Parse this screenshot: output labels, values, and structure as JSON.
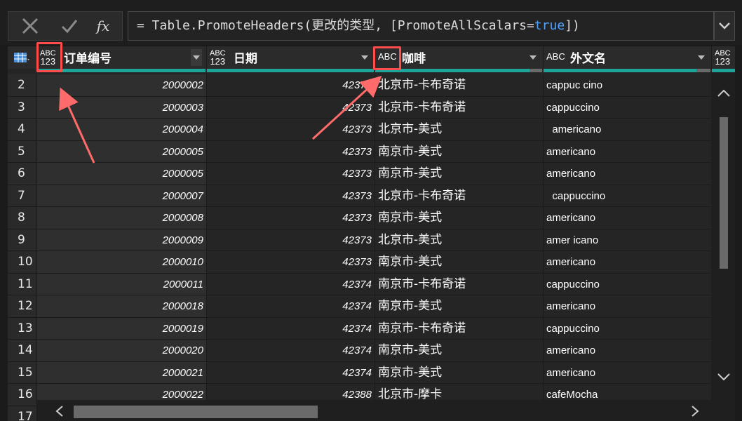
{
  "formula_bar": {
    "cancel_icon": "x-icon",
    "confirm_icon": "check-icon",
    "fx_label": "fx",
    "formula_prefix": "= Table.PromoteHeaders(更改的类型, [PromoteAllScalars=",
    "formula_keyword": "true",
    "formula_suffix": "])"
  },
  "columns": [
    {
      "type_badge_top": "ABC",
      "type_badge_bottom": "123",
      "name": "订单编号"
    },
    {
      "type_badge_top": "ABC",
      "type_badge_bottom": "123",
      "name": "日期"
    },
    {
      "type_badge_top": "ABC",
      "type_badge_bottom": "",
      "name": "咖啡"
    },
    {
      "type_badge_top": "ABC",
      "type_badge_bottom": "",
      "name": "外文名"
    },
    {
      "type_badge_top": "ABC",
      "type_badge_bottom": "123",
      "name": ""
    }
  ],
  "rows": [
    {
      "n": "2",
      "id": "2000002",
      "date": "42373",
      "coffee": "北京市-卡布奇诺",
      "en": "cappuc cino"
    },
    {
      "n": "3",
      "id": "2000003",
      "date": "42373",
      "coffee": "北京市-卡布奇诺",
      "en": "cappuccino"
    },
    {
      "n": "4",
      "id": "2000004",
      "date": "42373",
      "coffee": "北京市-美式",
      "en": "  americano"
    },
    {
      "n": "5",
      "id": "2000005",
      "date": "42373",
      "coffee": "南京市-美式",
      "en": "americano"
    },
    {
      "n": "6",
      "id": "2000005",
      "date": "42373",
      "coffee": "南京市-美式",
      "en": "americano"
    },
    {
      "n": "7",
      "id": "2000007",
      "date": "42373",
      "coffee": "北京市-卡布奇诺",
      "en": "  cappuccino"
    },
    {
      "n": "8",
      "id": "2000008",
      "date": "42373",
      "coffee": "南京市-美式",
      "en": "americano"
    },
    {
      "n": "9",
      "id": "2000009",
      "date": "42373",
      "coffee": "北京市-美式",
      "en": "amer icano"
    },
    {
      "n": "10",
      "id": "2000010",
      "date": "42373",
      "coffee": "南京市-美式",
      "en": "americano"
    },
    {
      "n": "11",
      "id": "2000011",
      "date": "42374",
      "coffee": "南京市-卡布奇诺",
      "en": "cappuccino"
    },
    {
      "n": "12",
      "id": "2000018",
      "date": "42374",
      "coffee": "南京市-美式",
      "en": "americano"
    },
    {
      "n": "13",
      "id": "2000019",
      "date": "42374",
      "coffee": "南京市-卡布奇诺",
      "en": "cappuccino"
    },
    {
      "n": "14",
      "id": "2000020",
      "date": "42374",
      "coffee": "南京市-美式",
      "en": "americano"
    },
    {
      "n": "15",
      "id": "2000021",
      "date": "42374",
      "coffee": "南京市-美式",
      "en": "americano"
    },
    {
      "n": "16",
      "id": "2000022",
      "date": "42388",
      "coffee": "北京市-摩卡",
      "en": "cafeMocha"
    },
    {
      "n": "17",
      "id": "",
      "date": "",
      "coffee": "",
      "en": ""
    }
  ],
  "colors": {
    "accent": "#1ea59a",
    "highlight": "#ff4d4d"
  }
}
